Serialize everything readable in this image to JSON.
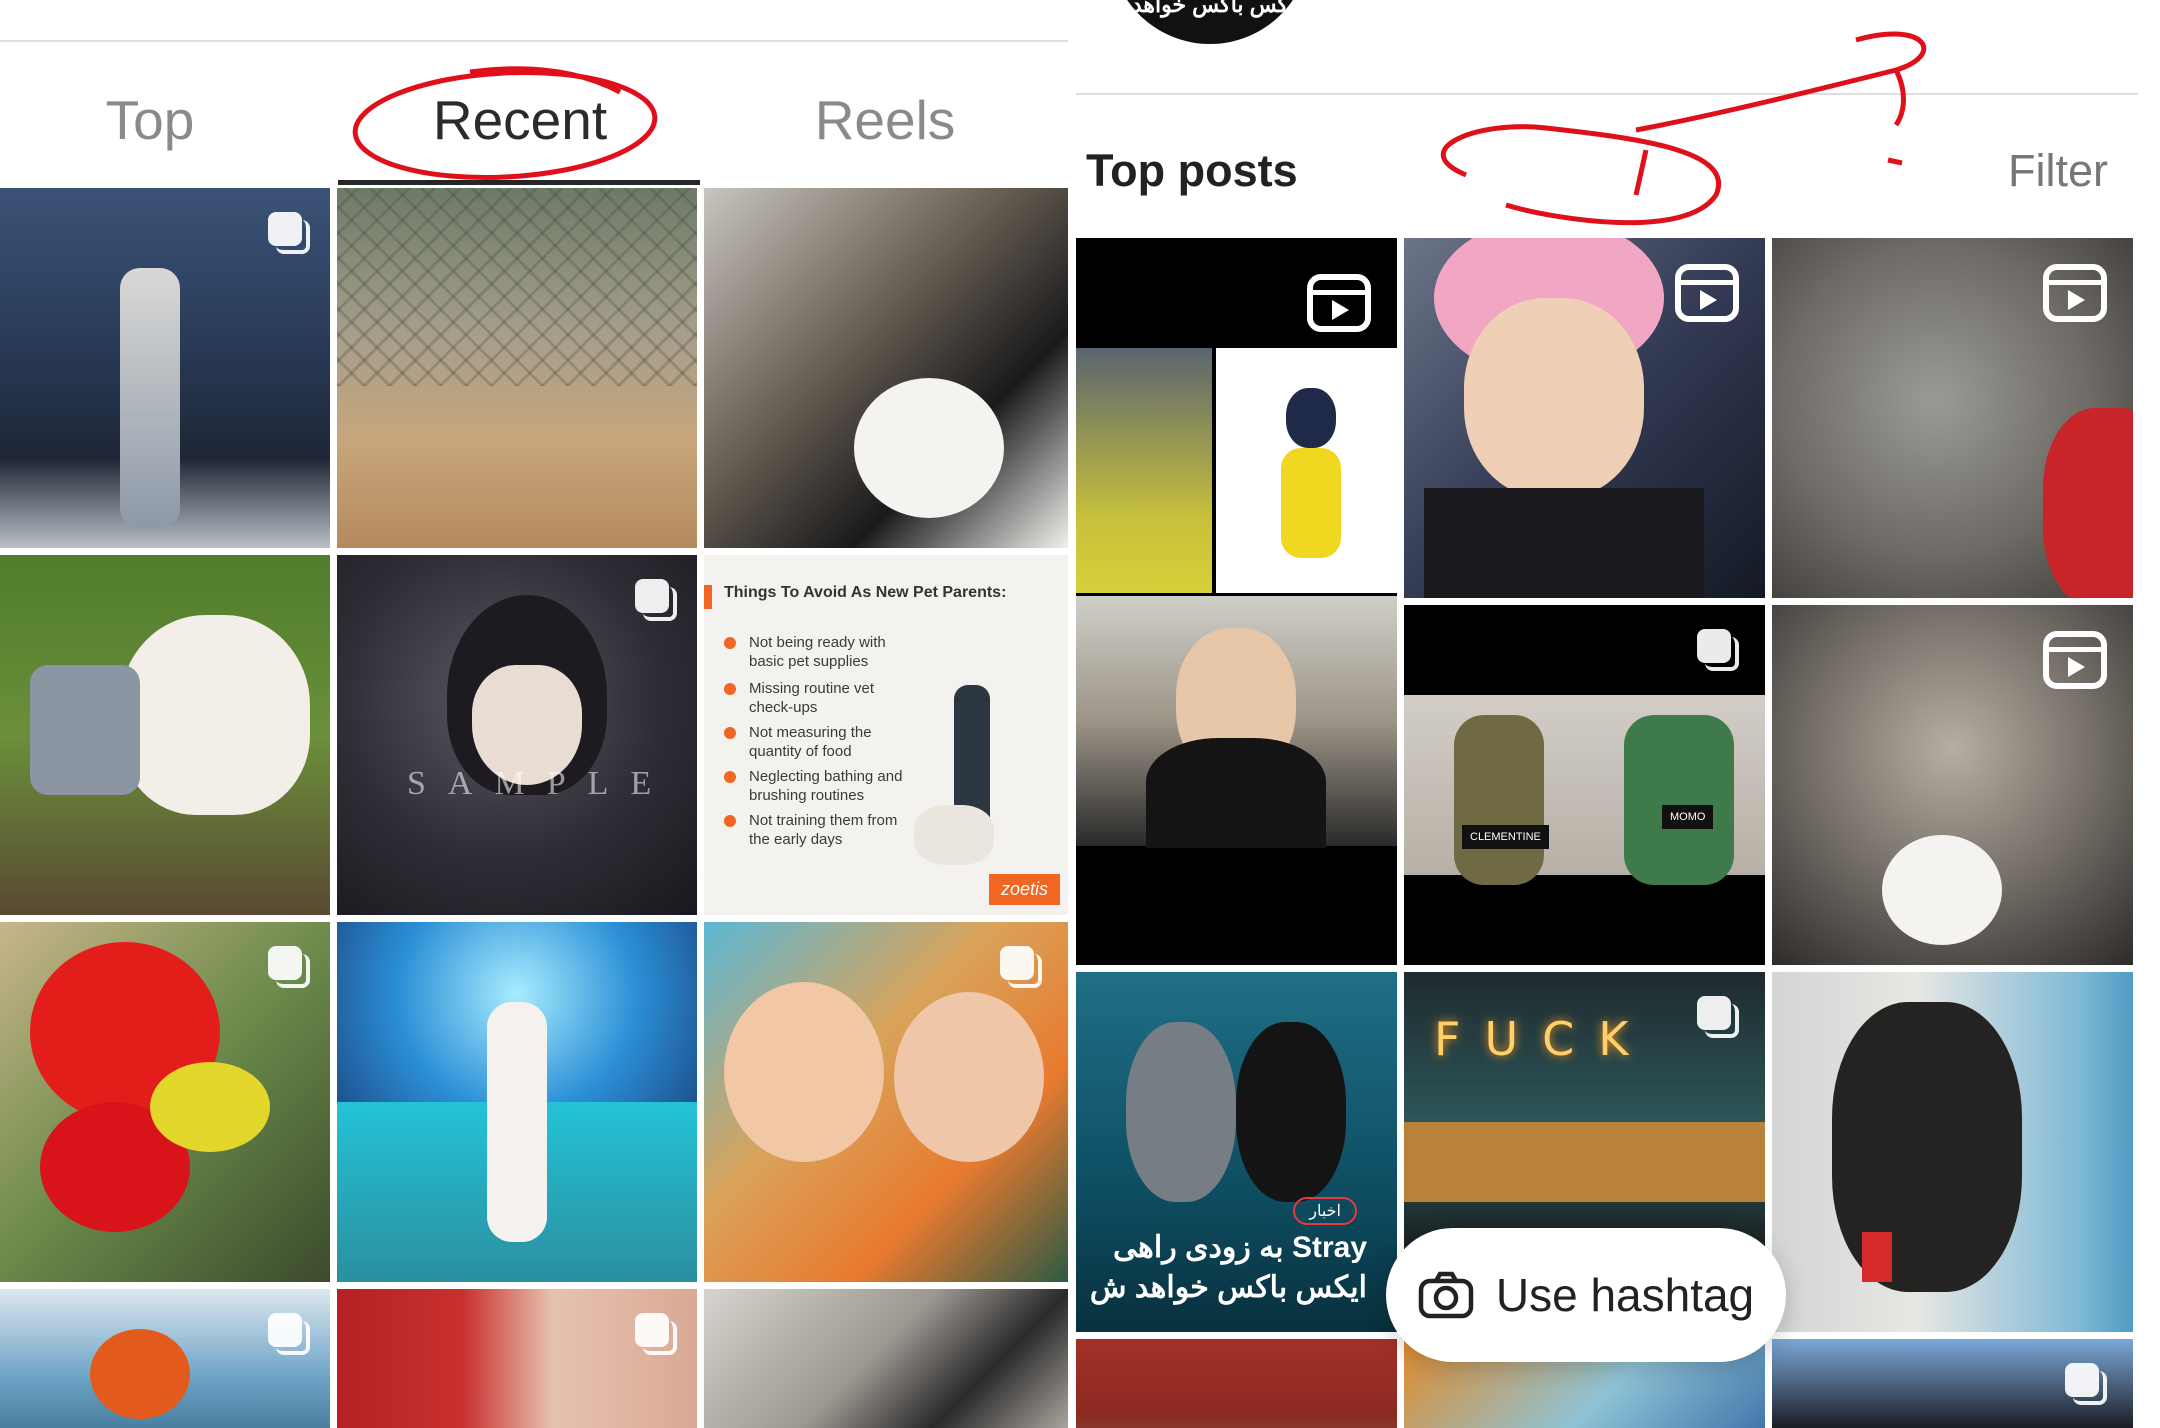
{
  "left": {
    "tabs": [
      {
        "label": "Top"
      },
      {
        "label": "Recent"
      },
      {
        "label": "Reels"
      }
    ],
    "post_card": {
      "title": "Things To Avoid As New Pet Parents:",
      "items": [
        "Not being ready with basic pet supplies",
        "Missing routine vet check-ups",
        "Not measuring the quantity of food",
        "Neglecting bathing and brushing routines",
        "Not training them from the early days"
      ],
      "brand": "zoetis"
    },
    "anime_watermark": "SAMPLE"
  },
  "right": {
    "header_partial": "کس باکس خواهد",
    "section_title": "Top posts",
    "filter_label": "Filter",
    "stray_post": {
      "tag": "اخبار",
      "line1": "Stray به زودی راهی",
      "line2": "ایکس باکس خواهد ش"
    },
    "neon_sign": "FUCK",
    "mugshot_labels": [
      "CLEMENTINE",
      "MOMO"
    ],
    "use_hashtag_label": "Use hashtag"
  },
  "colors": {
    "annotation_red": "#e0101a",
    "zoetis_orange": "#f26522"
  }
}
